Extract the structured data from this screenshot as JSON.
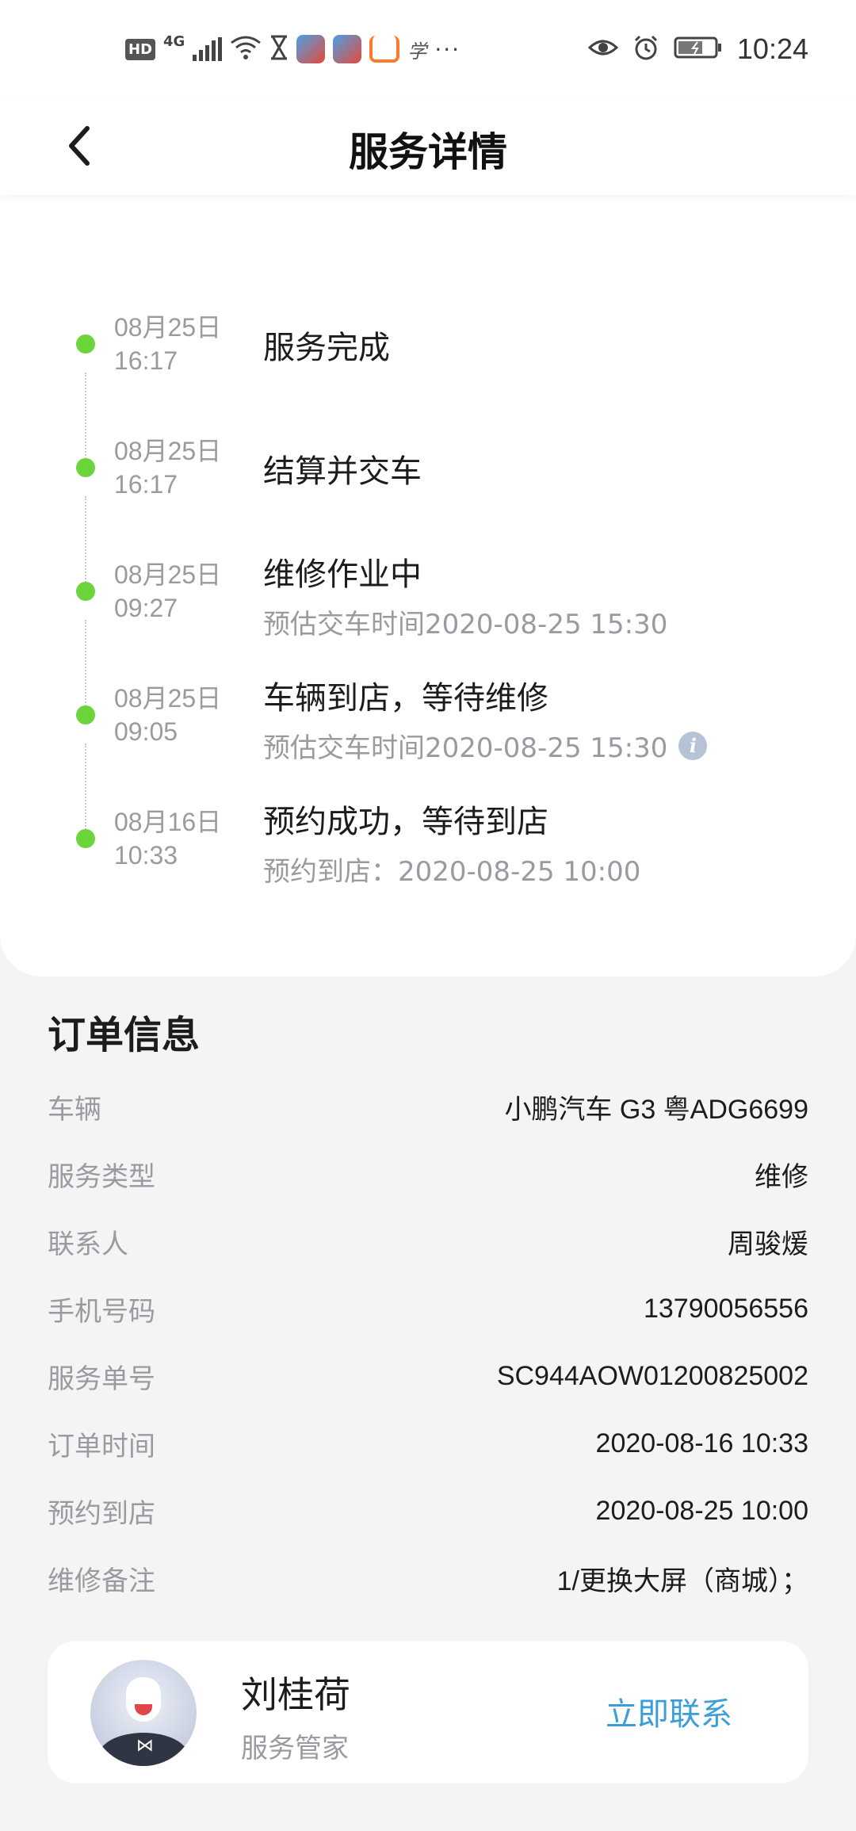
{
  "status_bar": {
    "hd": "HD",
    "network": "4G",
    "more": "···",
    "time": "10:24",
    "icons": [
      "eye-icon",
      "alarm-icon",
      "battery-icon"
    ]
  },
  "header": {
    "title": "服务详情"
  },
  "timeline": [
    {
      "date": "08月25日",
      "time": "16:17",
      "title": "服务完成",
      "sub": ""
    },
    {
      "date": "08月25日",
      "time": "16:17",
      "title": "结算并交车",
      "sub": ""
    },
    {
      "date": "08月25日",
      "time": "09:27",
      "title": "维修作业中",
      "sub": "预估交车时间2020-08-25 15:30"
    },
    {
      "date": "08月25日",
      "time": "09:05",
      "title": "车辆到店，等待维修",
      "sub": "预估交车时间2020-08-25 15:30"
    },
    {
      "date": "08月16日",
      "time": "10:33",
      "title": "预约成功，等待到店",
      "sub": "预约到店：2020-08-25 10:00"
    }
  ],
  "order": {
    "title": "订单信息",
    "rows": [
      {
        "label": "车辆",
        "value": "小鹏汽车 G3 粤ADG6699"
      },
      {
        "label": "服务类型",
        "value": "维修"
      },
      {
        "label": "联系人",
        "value": "周骏煖"
      },
      {
        "label": "手机号码",
        "value": "13790056556"
      },
      {
        "label": "服务单号",
        "value": "SC944AOW01200825002"
      },
      {
        "label": "订单时间",
        "value": "2020-08-16 10:33"
      },
      {
        "label": "预约到店",
        "value": "2020-08-25 10:00"
      },
      {
        "label": "维修备注",
        "value": "1/更换大屏（商城）；"
      }
    ]
  },
  "advisor": {
    "name": "刘桂荷",
    "role": "服务管家",
    "contact_label": "立即联系"
  },
  "colors": {
    "timeline_dot": "#6ad43a",
    "link": "#3a9fd8",
    "muted_text": "#9a9aa0"
  }
}
